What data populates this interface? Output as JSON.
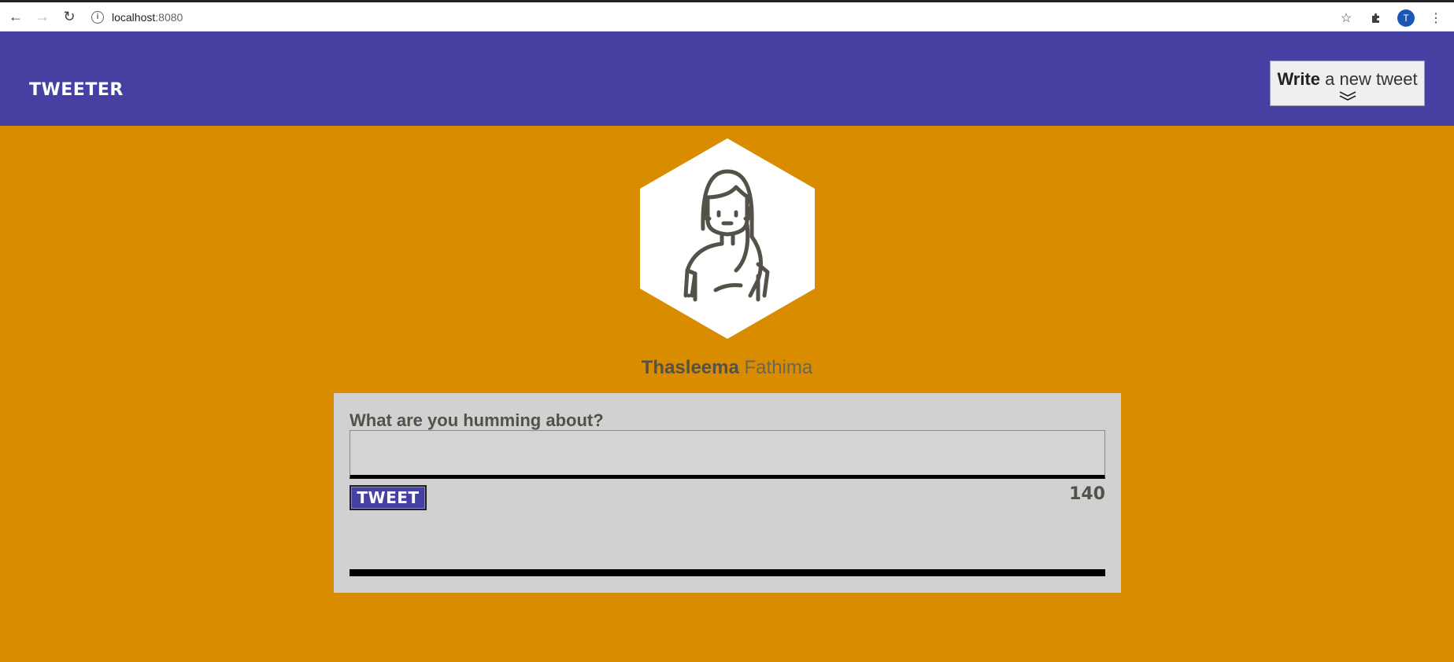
{
  "browser": {
    "url_host": "localhost",
    "url_port": ":8080",
    "profile_initial": "T"
  },
  "header": {
    "brand": "TWEETER",
    "write_bold": "Write",
    "write_rest": " a new tweet"
  },
  "profile": {
    "first_name": "Thasleema",
    "last_name": "Fathima",
    "avatar_icon": "woman-avatar-icon"
  },
  "compose": {
    "label": "What are you humming about?",
    "textarea_value": "",
    "button_label": "TWEET",
    "counter": "140"
  },
  "colors": {
    "background": "#d98c00",
    "header": "#4740a3",
    "card": "#d1d1d1",
    "text": "#545149"
  }
}
